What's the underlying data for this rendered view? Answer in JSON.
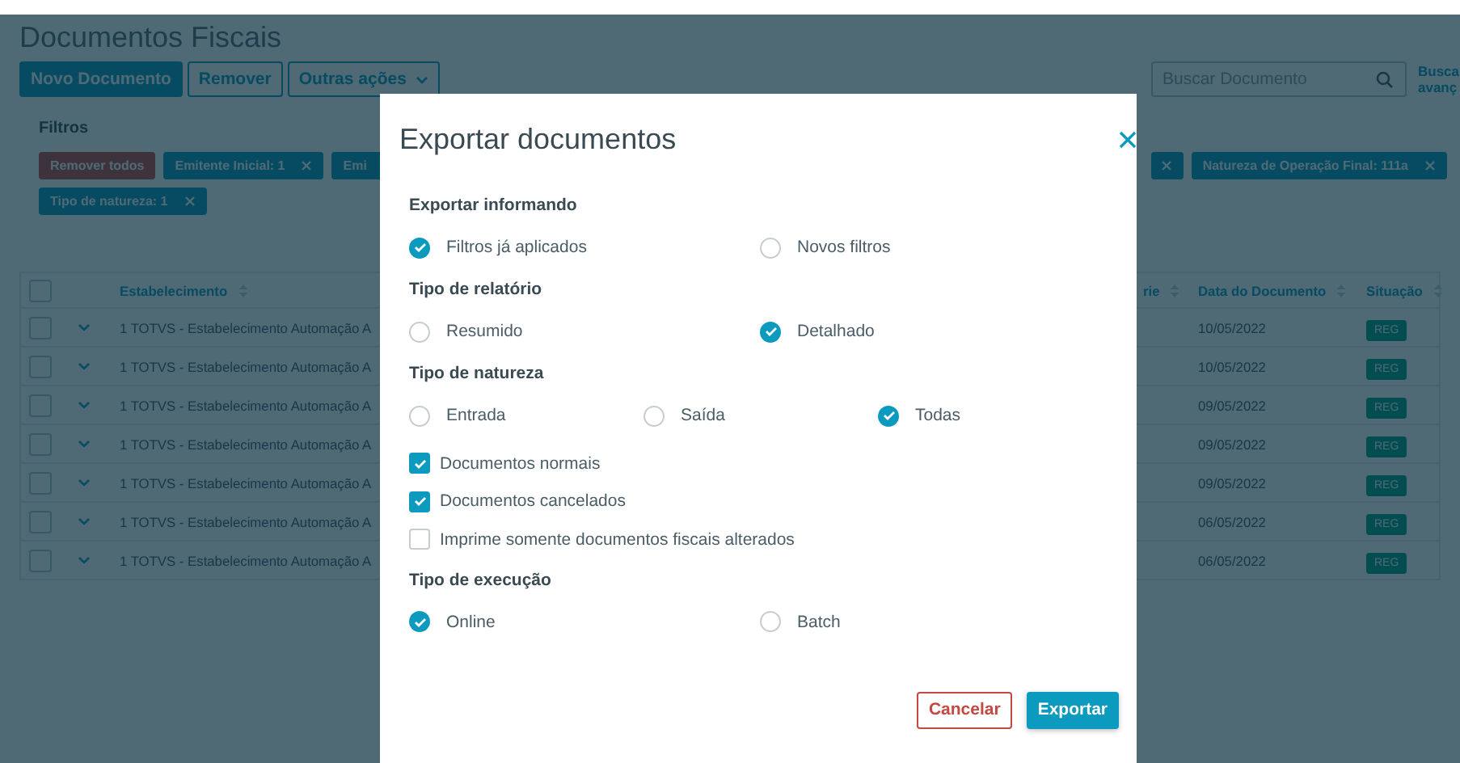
{
  "page": {
    "title": "Documentos Fiscais",
    "actions": [
      {
        "label": "Novo Documento",
        "kind": "primary"
      },
      {
        "label": "Remover",
        "kind": "secondary"
      },
      {
        "label": "Outras ações",
        "kind": "dropdown"
      }
    ],
    "search": {
      "placeholder": "Buscar Documento"
    },
    "advanced_search": "Busca avanç"
  },
  "filters": {
    "title": "Filtros",
    "chips_left": [
      {
        "label": "Remover todos",
        "kind": "clear"
      },
      {
        "label": "Emitente Inicial: 1",
        "kind": "filter"
      },
      {
        "label": "Emi",
        "kind": "partial"
      }
    ],
    "chips_right": [
      {
        "kind": "covered"
      },
      {
        "label": "Natureza de Operação Final: 111a",
        "kind": "filter"
      }
    ],
    "chips_row2": [
      {
        "label": "Tipo de natureza: 1",
        "kind": "filter"
      }
    ]
  },
  "table": {
    "all_selected": false,
    "columns_left": [
      {
        "label": "Estabelecimento"
      }
    ],
    "columns_right": [
      {
        "label": "rie"
      },
      {
        "label": "Data do Documento"
      },
      {
        "label": "Situação"
      }
    ],
    "rows": [
      {
        "selected": false,
        "establishment": "1 TOTVS - Estabelecimento Automação A",
        "date": "10/05/2022",
        "status": "REG"
      },
      {
        "selected": false,
        "establishment": "1 TOTVS - Estabelecimento Automação A",
        "date": "10/05/2022",
        "status": "REG"
      },
      {
        "selected": false,
        "establishment": "1 TOTVS - Estabelecimento Automação A",
        "date": "09/05/2022",
        "status": "REG"
      },
      {
        "selected": false,
        "establishment": "1 TOTVS - Estabelecimento Automação A",
        "date": "09/05/2022",
        "status": "REG"
      },
      {
        "selected": false,
        "establishment": "1 TOTVS - Estabelecimento Automação A",
        "date": "09/05/2022",
        "status": "REG"
      },
      {
        "selected": false,
        "establishment": "1 TOTVS - Estabelecimento Automação A",
        "date": "06/05/2022",
        "status": "REG"
      },
      {
        "selected": false,
        "establishment": "1 TOTVS - Estabelecimento Automação A",
        "date": "06/05/2022",
        "status": "REG"
      }
    ]
  },
  "modal": {
    "title": "Exportar documentos",
    "sections": [
      {
        "kind": "radio",
        "title": "Exportar informando",
        "options": [
          {
            "label": "Filtros já aplicados",
            "selected": true
          },
          {
            "label": "Novos filtros",
            "selected": false
          }
        ]
      },
      {
        "kind": "radio",
        "title": "Tipo de relatório",
        "options": [
          {
            "label": "Resumido",
            "selected": false
          },
          {
            "label": "Detalhado",
            "selected": true
          }
        ]
      },
      {
        "kind": "radio",
        "title": "Tipo de natureza",
        "options": [
          {
            "label": "Entrada",
            "selected": false
          },
          {
            "label": "Saída",
            "selected": false
          },
          {
            "label": "Todas",
            "selected": true
          }
        ]
      },
      {
        "kind": "checkbox",
        "options": [
          {
            "label": "Documentos normais",
            "checked": true
          },
          {
            "label": "Documentos cancelados",
            "checked": true
          },
          {
            "label": "Imprime somente documentos fiscais alterados",
            "checked": false
          }
        ]
      },
      {
        "kind": "radio",
        "title": "Tipo de execução",
        "options": [
          {
            "label": "Online",
            "selected": true
          },
          {
            "label": "Batch",
            "selected": false
          }
        ]
      }
    ],
    "buttons": [
      {
        "label": "Cancelar",
        "kind": "secondary"
      },
      {
        "label": "Exportar",
        "kind": "primary"
      }
    ]
  }
}
